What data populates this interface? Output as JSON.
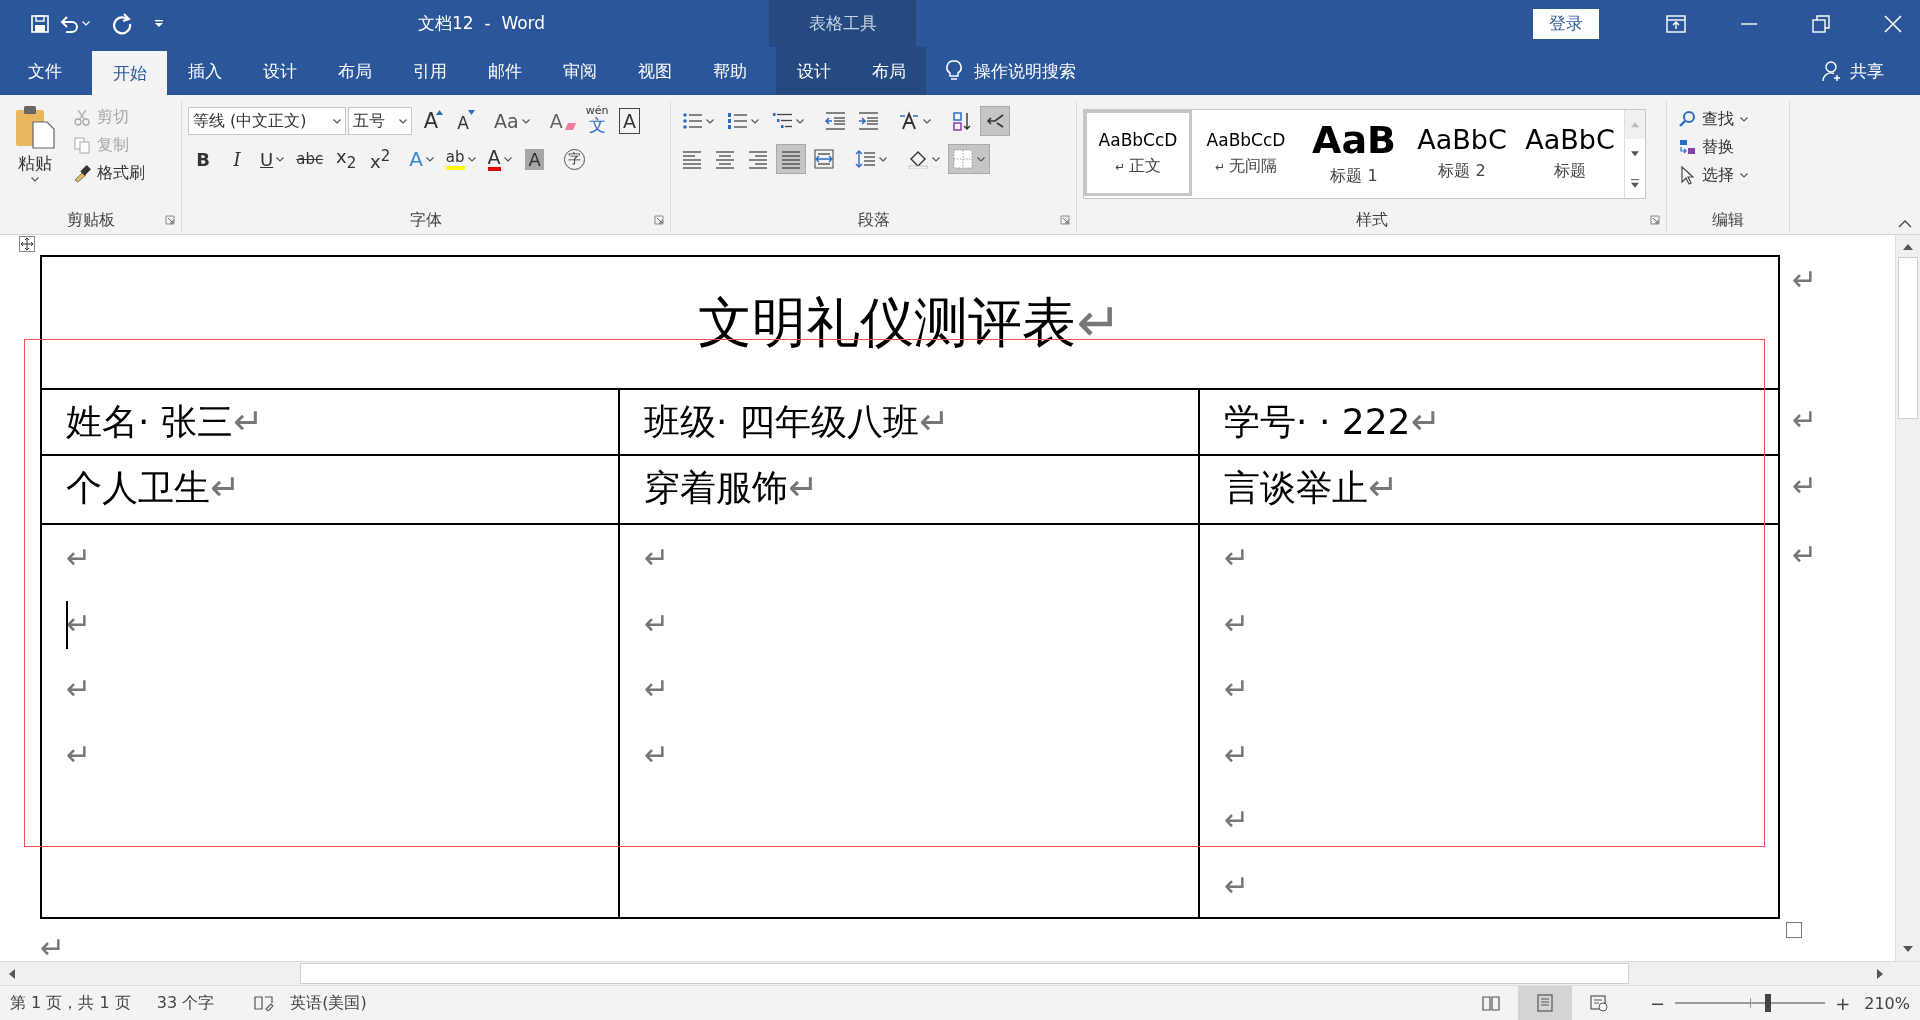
{
  "title_bar": {
    "title": "文档12  -  Word",
    "context_label": "表格工具",
    "sign_in": "登录"
  },
  "tabs": [
    {
      "label": "文件",
      "selected": false,
      "contextual": false
    },
    {
      "label": "开始",
      "selected": true,
      "contextual": false
    },
    {
      "label": "插入",
      "selected": false,
      "contextual": false
    },
    {
      "label": "设计",
      "selected": false,
      "contextual": false
    },
    {
      "label": "布局",
      "selected": false,
      "contextual": false
    },
    {
      "label": "引用",
      "selected": false,
      "contextual": false
    },
    {
      "label": "邮件",
      "selected": false,
      "contextual": false
    },
    {
      "label": "审阅",
      "selected": false,
      "contextual": false
    },
    {
      "label": "视图",
      "selected": false,
      "contextual": false
    },
    {
      "label": "帮助",
      "selected": false,
      "contextual": false
    },
    {
      "label": "设计",
      "selected": false,
      "contextual": true
    },
    {
      "label": "布局",
      "selected": false,
      "contextual": true
    }
  ],
  "tell_me": "操作说明搜索",
  "share": "共享",
  "ribbon": {
    "clipboard": {
      "label": "剪贴板",
      "paste": "粘贴",
      "items": [
        {
          "label": "剪切",
          "disabled": true
        },
        {
          "label": "复制",
          "disabled": true
        },
        {
          "label": "格式刷",
          "disabled": false
        }
      ]
    },
    "font": {
      "label": "字体",
      "font_name": "等线 (中文正文)",
      "font_size": "五号",
      "row1": [
        {
          "kind": "grow",
          "text": "A",
          "dropdown": false
        },
        {
          "kind": "shrink",
          "text": "A",
          "dropdown": false
        },
        {
          "kind": "case",
          "text": "Aa",
          "dropdown": true
        },
        {
          "kind": "clear",
          "text": "A",
          "dropdown": false
        },
        {
          "kind": "pinyin",
          "text": "文",
          "ruby": "wén",
          "dropdown": false
        },
        {
          "kind": "border",
          "text": "A",
          "dropdown": false
        }
      ],
      "row2": [
        {
          "kind": "bold",
          "text": "B",
          "dropdown": false
        },
        {
          "kind": "italic",
          "text": "I",
          "dropdown": false
        },
        {
          "kind": "underline",
          "text": "U",
          "dropdown": true
        },
        {
          "kind": "strike",
          "text": "abc",
          "dropdown": false
        },
        {
          "kind": "sub",
          "text": "x$_{2}$",
          "dropdown": false
        },
        {
          "kind": "sup",
          "text": "x$^{2}$",
          "dropdown": false
        },
        {
          "kind": "effects",
          "text": "A",
          "dropdown": true
        },
        {
          "kind": "highlight",
          "text": "ab",
          "dropdown": true
        },
        {
          "kind": "color",
          "text": "A",
          "dropdown": true
        },
        {
          "kind": "shading",
          "text": "A",
          "dropdown": false
        },
        {
          "kind": "enclosed",
          "text": "字",
          "dropdown": false
        }
      ]
    },
    "paragraph": {
      "label": "段落",
      "row1": [
        {
          "dropdown": true,
          "selected": false
        },
        {
          "dropdown": true,
          "selected": false
        },
        {
          "dropdown": true,
          "selected": false
        },
        {
          "dropdown": false,
          "selected": false
        },
        {
          "dropdown": false,
          "selected": false
        },
        {
          "dropdown": true,
          "selected": false
        },
        {
          "dropdown": false,
          "selected": false
        },
        {
          "dropdown": false,
          "selected": true
        }
      ],
      "row2": [
        {
          "dropdown": false,
          "selected": false
        },
        {
          "dropdown": false,
          "selected": false
        },
        {
          "dropdown": false,
          "selected": false
        },
        {
          "dropdown": false,
          "selected": true
        },
        {
          "dropdown": false,
          "selected": false
        },
        {
          "dropdown": true,
          "selected": false
        },
        {
          "dropdown": true,
          "selected": false
        },
        {
          "dropdown": true,
          "selected": true
        }
      ]
    },
    "styles": {
      "label": "样式",
      "items": [
        {
          "kind": "normal",
          "preview": "AaBbCcD",
          "name": "正文",
          "mark": "↵",
          "selected": true
        },
        {
          "kind": "normal",
          "preview": "AaBbCcD",
          "name": "无间隔",
          "mark": "↵",
          "selected": false
        },
        {
          "kind": "heading1",
          "preview": "AaB",
          "name": "标题 1",
          "selected": false
        },
        {
          "kind": "heading2",
          "preview": "AaBbC",
          "name": "标题 2",
          "selected": false
        },
        {
          "kind": "title",
          "preview": "AaBbC",
          "name": "标题",
          "selected": false
        }
      ]
    },
    "editing": {
      "label": "编辑",
      "items": [
        {
          "label": "查找",
          "dropdown": true
        },
        {
          "label": "替换",
          "dropdown": false
        },
        {
          "label": "选择",
          "dropdown": true
        }
      ]
    }
  },
  "document": {
    "table": {
      "title": {
        "text": "文明礼仪测评表",
        "mark": "↵"
      },
      "header_rows": [
        [
          {
            "text": "姓名· 张三",
            "mark": "↵"
          },
          {
            "text": "班级· 四年级八班",
            "mark": "↵"
          },
          {
            "text": "学号· · 222",
            "mark": "↵"
          }
        ],
        [
          {
            "text": "个人卫生",
            "mark": "↵"
          },
          {
            "text": "穿着服饰",
            "mark": "↵"
          },
          {
            "text": "言谈举止",
            "mark": "↵"
          }
        ]
      ],
      "body": [
        [
          {
            "mark": "↵",
            "cursor": false
          },
          {
            "mark": "↵",
            "cursor": true
          },
          {
            "mark": "↵",
            "cursor": false
          },
          {
            "mark": "↵",
            "cursor": false
          }
        ],
        [
          {
            "mark": "↵",
            "cursor": false
          },
          {
            "mark": "↵",
            "cursor": false
          },
          {
            "mark": "↵",
            "cursor": false
          },
          {
            "mark": "↵",
            "cursor": false
          }
        ],
        [
          {
            "mark": "↵",
            "cursor": false
          },
          {
            "mark": "↵",
            "cursor": false
          },
          {
            "mark": "↵",
            "cursor": false
          },
          {
            "mark": "↵",
            "cursor": false
          },
          {
            "mark": "↵",
            "cursor": false
          },
          {
            "mark": "↵",
            "cursor": false
          }
        ]
      ],
      "row_end_marks": [
        "↵",
        "↵",
        "↵",
        "↵"
      ]
    },
    "end_mark": "↵",
    "annotation": {
      "color": "#f25050"
    }
  },
  "status_bar": {
    "page": "第 1 页，共 1 页",
    "words": "33 个字",
    "language": "英语(美国)",
    "views": [
      {
        "selected": false
      },
      {
        "selected": true
      },
      {
        "selected": false
      }
    ],
    "zoom_out": "−",
    "zoom_in": "+",
    "zoom": {
      "level": 0.62
    },
    "zoom_percent": "210%"
  }
}
